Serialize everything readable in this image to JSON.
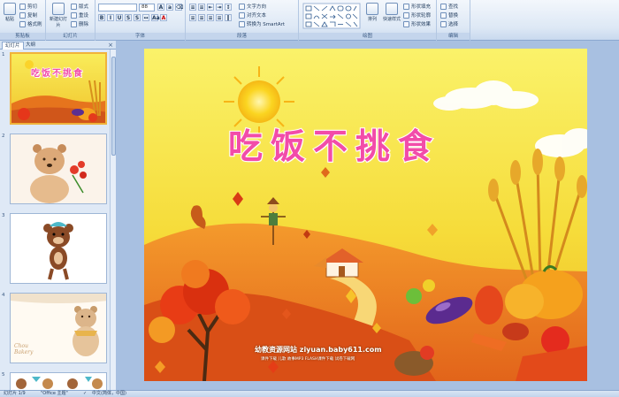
{
  "ribbon": {
    "clipboard": {
      "label": "剪贴板",
      "paste": "粘贴",
      "cut": "剪切",
      "copy": "复制",
      "format_painter": "格式刷"
    },
    "slides": {
      "label": "幻灯片",
      "new_slide": "新建幻灯片",
      "layout": "版式",
      "reset": "重设",
      "delete": "删除"
    },
    "font": {
      "label": "字体",
      "font_name": "",
      "font_size": "88"
    },
    "paragraph": {
      "label": "段落",
      "text_direction": "文字方向",
      "align_text": "对齐文本",
      "smartart": "转换为 SmartArt"
    },
    "drawing": {
      "label": "绘图",
      "arrange": "排列",
      "quick_styles": "快速样式",
      "shape_fill": "形状填充",
      "shape_outline": "形状轮廓",
      "shape_effects": "形状效果"
    },
    "editing": {
      "label": "编辑",
      "find": "查找",
      "replace": "替换",
      "select": "选择"
    }
  },
  "panel": {
    "tab_slides": "幻灯片",
    "tab_outline": "大纲",
    "close": "×"
  },
  "thumbnails": [
    {
      "number": "1",
      "title": "吃饭不挑食"
    },
    {
      "number": "2"
    },
    {
      "number": "3"
    },
    {
      "number": "4",
      "caption": "Chou Bakery"
    },
    {
      "number": "5"
    }
  ],
  "slide": {
    "title": "吃饭不挑食",
    "footer_line1": "幼教资源网站  ziyuan.baby611.com",
    "footer_line2": "课件下载   儿歌   故事MP3   FLASH课件下载   试卷下载网"
  },
  "status": {
    "slide_index": "幻灯片 1/9",
    "theme": "\"Office 主题\"",
    "language": "中文(简体，中国)"
  },
  "colors": {
    "accent": "#f24ca9",
    "ribbon": "#dde8f5",
    "selected_thumb": "#f0b33a"
  }
}
